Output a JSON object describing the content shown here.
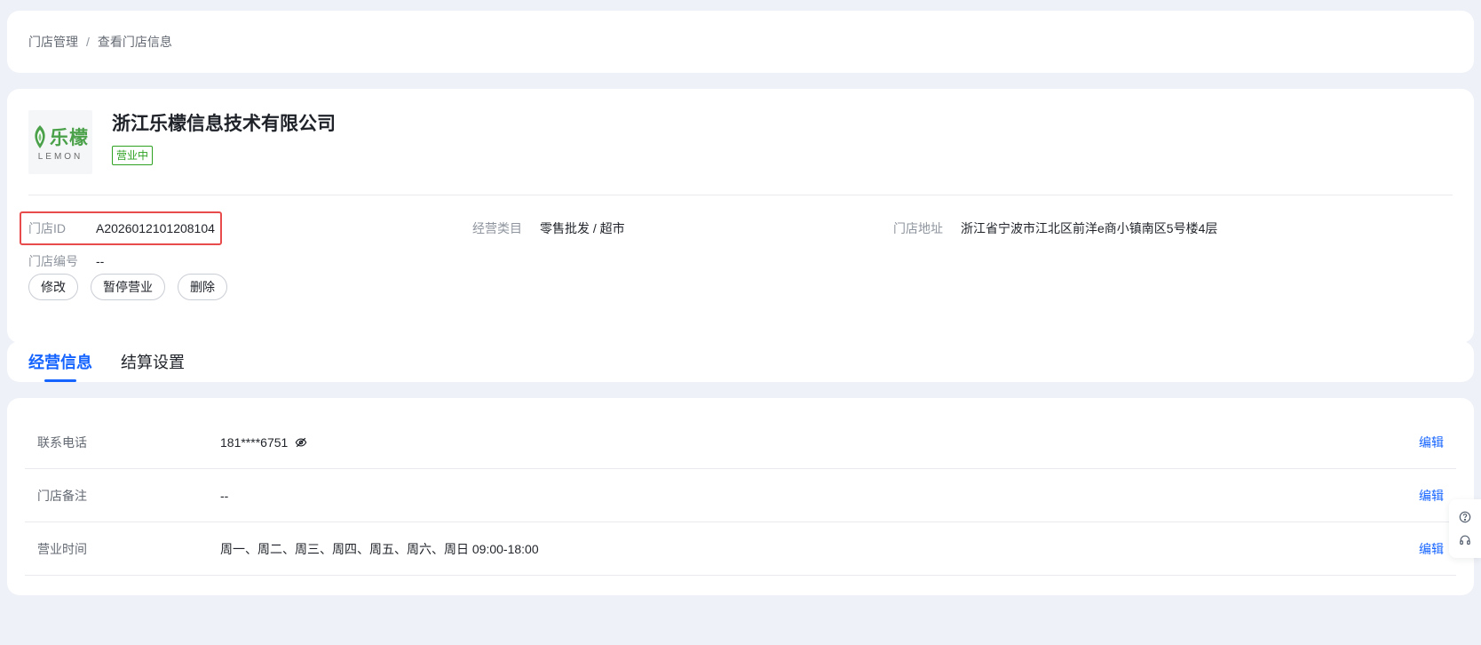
{
  "breadcrumb": {
    "root": "门店管理",
    "separator": "/",
    "current": "查看门店信息"
  },
  "store": {
    "logo": {
      "cn": "乐檬",
      "en": "LEMON"
    },
    "name": "浙江乐檬信息技术有限公司",
    "status": "营业中",
    "fields": {
      "id": {
        "label": "门店ID",
        "value": "A2026012101208104"
      },
      "category": {
        "label": "经营类目",
        "value": "零售批发 / 超市"
      },
      "address": {
        "label": "门店地址",
        "value": "浙江省宁波市江北区前洋e商小镇南区5号楼4层"
      },
      "code": {
        "label": "门店编号",
        "value": "--"
      }
    },
    "actions": {
      "edit": "修改",
      "pause": "暂停营业",
      "delete": "删除"
    }
  },
  "tabs": [
    {
      "label": "经营信息",
      "active": true
    },
    {
      "label": "结算设置",
      "active": false
    }
  ],
  "details": [
    {
      "label": "联系电话",
      "value": "181****6751",
      "edit": "编辑",
      "icon": "eye-off-icon"
    },
    {
      "label": "门店备注",
      "value": "--",
      "edit": "编辑"
    },
    {
      "label": "营业时间",
      "value": "周一、周二、周三、周四、周五、周六、周日 09:00-18:00",
      "edit": "编辑"
    }
  ],
  "side_tools": [
    "help-icon",
    "headset-icon"
  ],
  "colors": {
    "accent": "#1664ff",
    "status_green": "#2ea121",
    "highlight_red": "#e84b4b",
    "background": "#eef1f7"
  }
}
